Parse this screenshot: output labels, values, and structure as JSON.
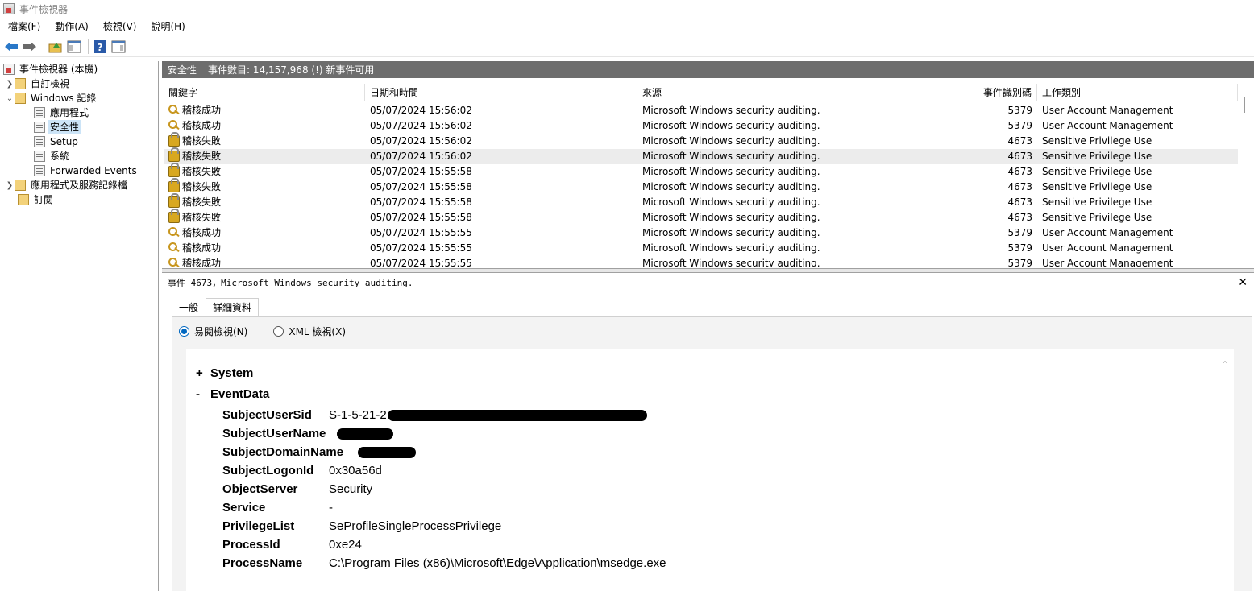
{
  "window": {
    "title": "事件檢視器"
  },
  "menu": [
    "檔案(F)",
    "動作(A)",
    "檢視(V)",
    "說明(H)"
  ],
  "tree": {
    "root": "事件檢視器 (本機)",
    "custom_views": "自訂檢視",
    "windows_logs": "Windows 記錄",
    "app": "應用程式",
    "security": "安全性",
    "setup": "Setup",
    "system": "系統",
    "forwarded": "Forwarded Events",
    "app_services": "應用程式及服務記錄檔",
    "subscriptions": "訂閱"
  },
  "panel": {
    "name": "安全性",
    "count": "事件數目: 14,157,968 (!) 新事件可用"
  },
  "columns": {
    "keyword": "關鍵字",
    "datetime": "日期和時間",
    "source": "來源",
    "event_id": "事件識別碼",
    "category": "工作類別"
  },
  "events": [
    {
      "icon": "key",
      "keyword": "稽核成功",
      "datetime": "05/07/2024 15:56:02",
      "source": "Microsoft Windows security auditing.",
      "event_id": "5379",
      "category": "User Account Management"
    },
    {
      "icon": "key",
      "keyword": "稽核成功",
      "datetime": "05/07/2024 15:56:02",
      "source": "Microsoft Windows security auditing.",
      "event_id": "5379",
      "category": "User Account Management"
    },
    {
      "icon": "lock",
      "keyword": "稽核失敗",
      "datetime": "05/07/2024 15:56:02",
      "source": "Microsoft Windows security auditing.",
      "event_id": "4673",
      "category": "Sensitive Privilege Use"
    },
    {
      "icon": "lock",
      "keyword": "稽核失敗",
      "datetime": "05/07/2024 15:56:02",
      "source": "Microsoft Windows security auditing.",
      "event_id": "4673",
      "category": "Sensitive Privilege Use"
    },
    {
      "icon": "lock",
      "keyword": "稽核失敗",
      "datetime": "05/07/2024 15:55:58",
      "source": "Microsoft Windows security auditing.",
      "event_id": "4673",
      "category": "Sensitive Privilege Use"
    },
    {
      "icon": "lock",
      "keyword": "稽核失敗",
      "datetime": "05/07/2024 15:55:58",
      "source": "Microsoft Windows security auditing.",
      "event_id": "4673",
      "category": "Sensitive Privilege Use"
    },
    {
      "icon": "lock",
      "keyword": "稽核失敗",
      "datetime": "05/07/2024 15:55:58",
      "source": "Microsoft Windows security auditing.",
      "event_id": "4673",
      "category": "Sensitive Privilege Use"
    },
    {
      "icon": "lock",
      "keyword": "稽核失敗",
      "datetime": "05/07/2024 15:55:58",
      "source": "Microsoft Windows security auditing.",
      "event_id": "4673",
      "category": "Sensitive Privilege Use"
    },
    {
      "icon": "key",
      "keyword": "稽核成功",
      "datetime": "05/07/2024 15:55:55",
      "source": "Microsoft Windows security auditing.",
      "event_id": "5379",
      "category": "User Account Management"
    },
    {
      "icon": "key",
      "keyword": "稽核成功",
      "datetime": "05/07/2024 15:55:55",
      "source": "Microsoft Windows security auditing.",
      "event_id": "5379",
      "category": "User Account Management"
    },
    {
      "icon": "key",
      "keyword": "稽核成功",
      "datetime": "05/07/2024 15:55:55",
      "source": "Microsoft Windows security auditing.",
      "event_id": "5379",
      "category": "User Account Management"
    }
  ],
  "detail": {
    "title": "事件 4673，Microsoft Windows security auditing.",
    "tab_general": "一般",
    "tab_details": "詳細資料",
    "radio_friendly": "易閱檢視(N)",
    "radio_xml": "XML 檢視(X)",
    "system_sign": "+",
    "system": "System",
    "eventdata_sign": "-",
    "eventdata": "EventData",
    "fields": [
      {
        "key": "SubjectUserSid",
        "value": "S-1-5-21-2"
      },
      {
        "key": "SubjectUserName",
        "value": ""
      },
      {
        "key": "SubjectDomainName",
        "value": ""
      },
      {
        "key": "SubjectLogonId",
        "value": "0x30a56d"
      },
      {
        "key": "ObjectServer",
        "value": "Security"
      },
      {
        "key": "Service",
        "value": "-"
      },
      {
        "key": "PrivilegeList",
        "value": "SeProfileSingleProcessPrivilege"
      },
      {
        "key": "ProcessId",
        "value": "0xe24"
      },
      {
        "key": "ProcessName",
        "value": "C:\\Program Files (x86)\\Microsoft\\Edge\\Application\\msedge.exe"
      }
    ]
  }
}
